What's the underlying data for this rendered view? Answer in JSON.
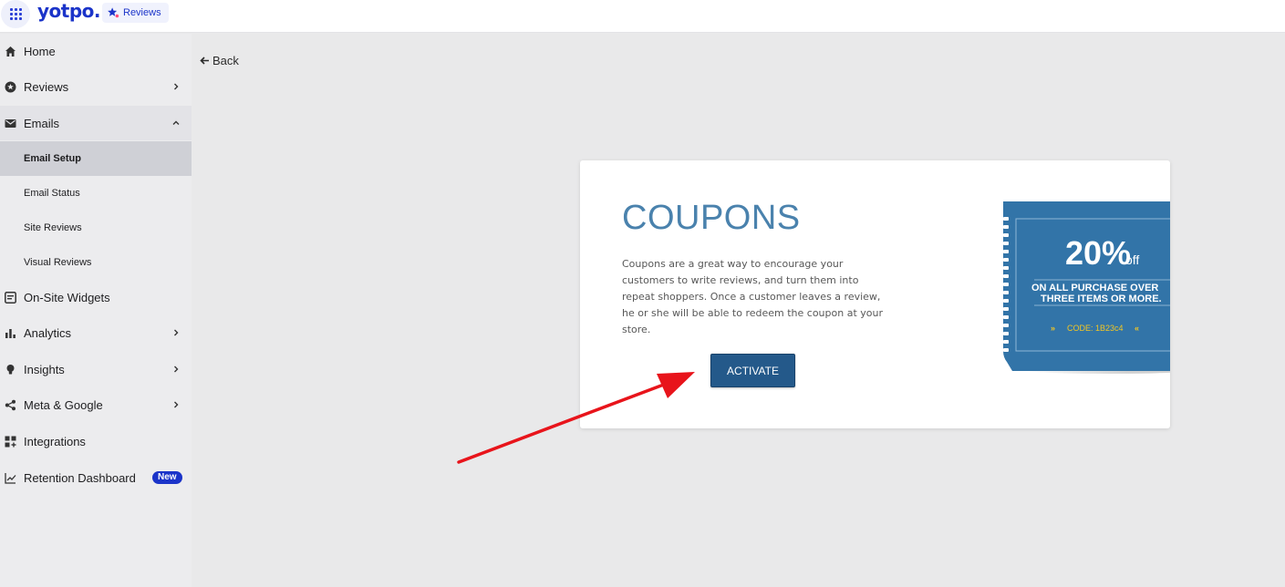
{
  "topbar": {
    "logo": "yotpo.",
    "product_label": "Reviews"
  },
  "sidebar": {
    "items": [
      {
        "label": "Home",
        "icon": "home-icon"
      },
      {
        "label": "Reviews",
        "icon": "star-circle-icon"
      },
      {
        "label": "Emails",
        "icon": "mail-icon"
      },
      {
        "label": "On-Site Widgets",
        "icon": "widget-icon"
      },
      {
        "label": "Analytics",
        "icon": "bar-chart-icon"
      },
      {
        "label": "Insights",
        "icon": "lightbulb-icon"
      },
      {
        "label": "Meta & Google",
        "icon": "share-icon"
      },
      {
        "label": "Integrations",
        "icon": "integrations-icon"
      },
      {
        "label": "Retention Dashboard",
        "icon": "line-chart-icon",
        "badge": "New"
      }
    ],
    "email_subitems": [
      "Email Setup",
      "Email Status",
      "Site Reviews",
      "Visual Reviews"
    ],
    "active_subitem": "Email Setup"
  },
  "main": {
    "back_label": "Back",
    "card": {
      "title": "COUPONS",
      "description": "Coupons are a great way to encourage your customers to write reviews, and turn them into repeat shoppers. Once a customer leaves a review, he or she will be able to redeem the coupon at your store.",
      "button_label": "ACTIVATE",
      "coupon": {
        "percent": "20%",
        "off": "off",
        "line1": "ON ALL PURCHASE OVER",
        "line2": "THREE ITEMS OR MORE.",
        "code": "CODE: 1B23c4"
      }
    }
  },
  "colors": {
    "brand": "#1b34c9",
    "coupon_blue": "#3274a8",
    "button_blue": "#24598a",
    "arrow_red": "#e8141b"
  }
}
